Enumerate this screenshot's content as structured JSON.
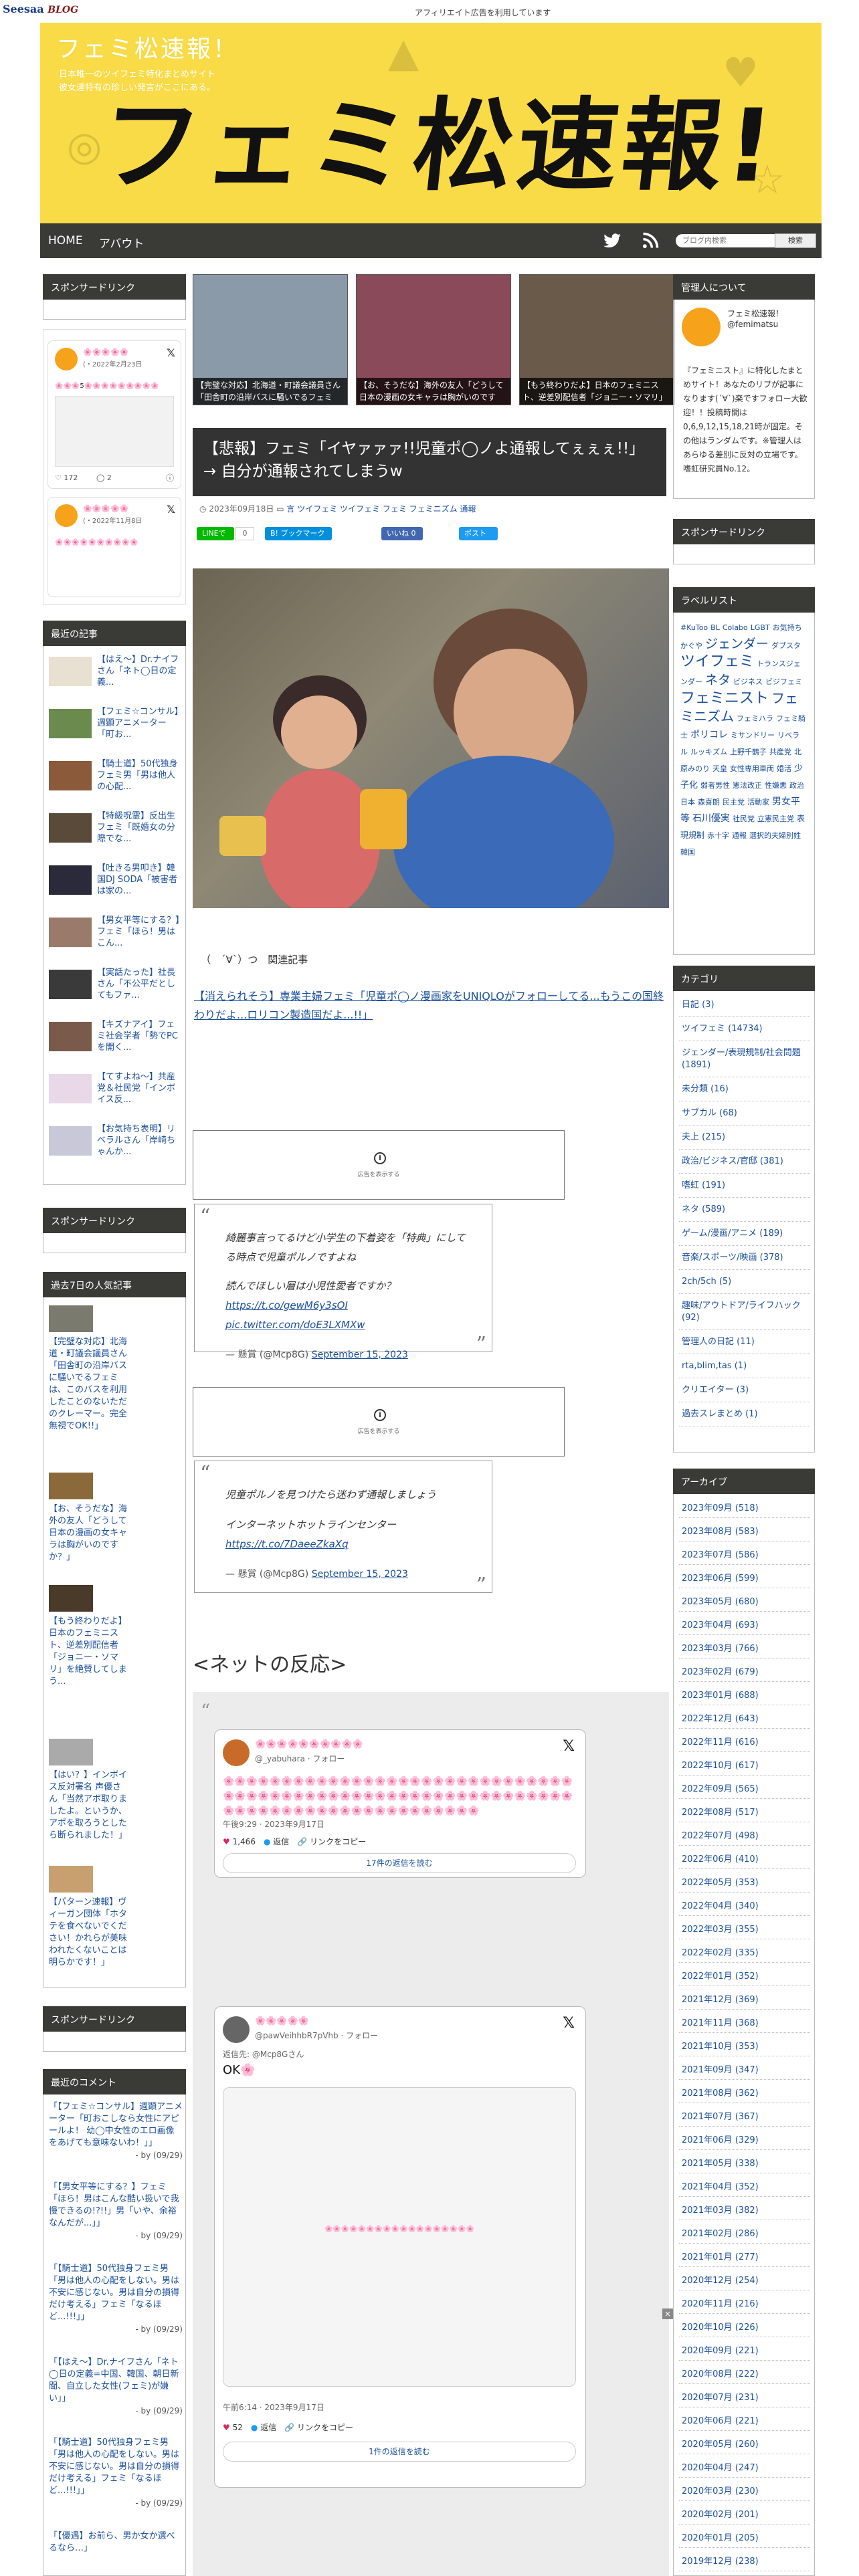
{
  "blog": {
    "logo_main": "Seesaa",
    "logo_sub": "BLOG",
    "ad_notice": "アフィリエイト広告を利用しています"
  },
  "header": {
    "title": "フェミ松速報！",
    "desc_1": "日本唯一のツイフェミ特化まとめサイト",
    "desc_2": "彼女達特有の珍しい発言がここにある。",
    "logo": "フェミ松速報!"
  },
  "nav": {
    "home": "HOME",
    "about": "アバウト",
    "search_placeholder": "ブログ内検索",
    "search_button": "検索"
  },
  "left": {
    "sponsor_title": "スポンサードリンク",
    "sponsor_title_2": "スポンサードリンク",
    "sponsor_title_3": "スポンサードリンク",
    "tweet1": {
      "name": "🌸🌸🌸🌸🌸",
      "date": "(・2022年2月23日",
      "text": "🌸🌸🌸5🌸🌸🌸🌸🌸🌸🌸🌸🌸",
      "likes": "172",
      "replies": "2"
    },
    "tweet2": {
      "name": "🌸🌸🌸🌸🌸",
      "date": "(・2022年11月8日",
      "text": "🌸🌸🌸🌸🌸🌸🌸🌸🌸🌸"
    },
    "recent_title": "最近の記事",
    "recent": [
      "【はえ〜】Dr.ナイフさん「ネト◯日の定義...",
      "【フェミ☆コンサル】週顕アニメーター「町お...",
      "【騎士道】50代独身フェミ男「男は他人の心配...",
      "【特級呪霊】反出生フェミ「既婚女の分際でな...",
      "【吐きる男叩き】韓国DJ SODA「被害者は家の...",
      "【男女平等にする？】フェミ「ほら！男はこん...",
      "【実話たった】社長さん「不公平だとしてもファ...",
      "【キズナアイ】フェミ社会学者「勢でPCを開く...",
      "【てすよね〜】共産党＆社民党「インボイス反...",
      "【お気持ち表明】リベラルさん「岸崎ちゃんか..."
    ],
    "popular_title": "過去7日の人気記事",
    "popular": [
      "【完璧な対応】北海道・町議会議員さん「田舎町の沿岸バスに騒いでるフェミは、このバスを利用したことのないただのクレーマー。完全無視でOK!!」",
      "【お、そうだな】海外の友人「どうして日本の漫画の女キャラは胸がいのですか？」",
      "【もう終わりだよ】日本のフェミニスト、逆差別配信者「ジョニー・ソマリ」を絶賛してしまう...",
      "【はい？】インボイス反対署名 声優さん「当然アボ取りましたよ。というか、アポを取ろうとしたら断られました！」",
      "【パターン速報】ヴィーガン団体「ホタテを食べないでください！かれらが美味われたくないことは明らかです！」"
    ],
    "comments_title": "最近のコメント",
    "comments": [
      {
        "text": "「【フェミ☆コンサル】週顕アニメーター「町おこしなら女性にアピールよ！ 幼◯中女性のエロ画像をあげても意味ないわ！」」",
        "by": "- by",
        "date": "(09/29)"
      },
      {
        "text": "「【男女平等にする？】フェミ「ほら！男はこんな酷い扱いで我慢できるの!?!!」男「いや、余裕なんだが...」」",
        "by": "- by",
        "date": "(09/29)"
      },
      {
        "text": "「【騎士道】50代独身フェミ男「男は他人の心配をしない。男は不安に感じない。男は自分の損得だけ考える」フェミ「なるほど...!!!」」",
        "by": "- by",
        "date": "(09/29)"
      },
      {
        "text": "「【はえ〜】Dr.ナイフさん「ネト◯日の定義=中国、韓国、朝日新聞、自立した女性(フェミ)が嫌い」」",
        "by": "- by",
        "date": "(09/29)"
      },
      {
        "text": "「【騎士道】50代独身フェミ男「男は他人の心配をしない。男は不安に感じない。男は自分の損得だけ考える」フェミ「なるほど...!!!」」",
        "by": "- by",
        "date": "(09/29)"
      },
      {
        "text": "「【優遇】お前ら、男か女か選べるなら…」",
        "by": "",
        "date": ""
      }
    ]
  },
  "main": {
    "featured": [
      "【完璧な対応】北海道・町議会議員さん「田舎町の沿岸バスに騒いでるフェミは...",
      "【お、そうだな】海外の友人「どうして日本の漫画の女キャラは胸がいのですか？」",
      "【もう終わりだよ】日本のフェミニスト、逆差別配信者「ジョニー・ソマリ」を絶賛"
    ],
    "title": "【悲報】フェミ「イヤァァァ!!児童ポ◯ノよ通報してぇぇぇ!!」→ 自分が通報されてしまうw",
    "date": "2023年09月18日",
    "categories": "言 ツイフェミ ツイフェミ フェミ フェミニズム 通報",
    "share_line": "LINEで送る",
    "share_line_count": "0",
    "share_hatena": "B! ブックマーク 4",
    "share_like": "いいね 0",
    "share_tweet": "ポスト",
    "related_label": "（　´∀`）つ　関連記事",
    "related_link": "【消えられそう】専業主婦フェミ「児童ポ◯ノ漫画家をUNIQLOがフォローしてる...もうこの国終わりだよ...ロリコン製造国だよ...!!」",
    "ad_label": "広告を表示する",
    "quote1": {
      "line1": "綺麗事言ってるけど小学生の下着姿を「特典」にして",
      "line1b": "る時点で児童ポルノですよね",
      "line2": "読んでほしい層は小児性愛者ですか？",
      "link": "https://t.co/gewM6y3sOI",
      "pic": "pic.twitter.com/doE3LXMXw",
      "attrib": "— 懸賞 (@Mcp8G)",
      "date": "September 15, 2023"
    },
    "quote2": {
      "line1": "児童ポルノを見つけたら迷わず通報しましょう",
      "line2": "インターネットホットラインセンター",
      "link": "https://t.co/7DaeeZkaXq",
      "attrib": "— 懸賞 (@Mcp8G)",
      "date": "September 15, 2023"
    },
    "net_heading": "<ネットの反応>",
    "embed1": {
      "name": "🌸🌸🌸🌸🌸🌸🌸🌸🌸🌸",
      "handle": "@_yabuhara · フォロー",
      "body": "🌸🌸🌸🌸🌸🌸🌸🌸🌸🌸🌸🌸🌸🌸🌸🌸🌸🌸🌸🌸🌸🌸🌸🌸🌸🌸🌸🌸🌸🌸🌸🌸🌸🌸🌸🌸🌸🌸🌸🌸🌸🌸🌸🌸🌸🌸🌸🌸🌸🌸🌸🌸🌸🌸🌸🌸🌸🌸🌸🌸🌸🌸🌸🌸🌸🌸🌸🌸🌸🌸🌸🌸🌸🌸🌸🌸🌸🌸🌸🌸🌸🌸",
      "time": "午後9:29 · 2023年9月17日",
      "likes": "1,466",
      "reply": "返信",
      "copy": "リンクをコピー",
      "more": "17件の返信を読む"
    },
    "embed2": {
      "name": "🌸🌸🌸🌸🌸",
      "handle": "@pawVeihhbR7pVhb · フォロー",
      "reply_to": "返信先: @Mcp8Gさん",
      "body": "OK🌸",
      "media_notice": "🌸🌸🌸🌸🌸🌸🌸🌸🌸🌸🌸🌸🌸🌸🌸🌸🌸🌸",
      "time": "午前6:14 · 2023年9月17日",
      "likes": "52",
      "reply": "返信",
      "copy": "リンクをコピー",
      "more": "1件の返信を読む"
    }
  },
  "right": {
    "about_title": "管理人について",
    "about_name": "フェミ松速報！",
    "about_handle": "@femimatsu",
    "about_text": "『フェミニスト』に特化したまとめサイト！あなたのリプが記事になります(´∀`)楽ですフォロー大歓迎！！投稿時間は0,6,9,12,15,18,21時が固定。その他はランダムです。※管理人はあらゆる差別に反対の立場です。嗜虹研究員No.12。",
    "sponsor_title": "スポンサードリンク",
    "labels_title": "ラベルリスト",
    "labels": [
      "#KuToo",
      "BL",
      "Colabo",
      "LGBT",
      "お気持ち",
      "かぐや",
      "ジェンダー",
      "ダブスタ",
      "ツイフェミ",
      "トランスジェンダー",
      "ネタ",
      "ビジネス",
      "ビジフェミ",
      "フェミニスト",
      "フェミニズム",
      "フェミハラ",
      "フェミ騎士",
      "ポリコレ",
      "ミサンドリー",
      "リベラル",
      "ルッキズム",
      "上野千鶴子",
      "共産党",
      "北原みのり",
      "天皇",
      "女性専用車両",
      "婚活",
      "少子化",
      "弱者男性",
      "憲法改正",
      "性嫌悪",
      "政治",
      "日本",
      "森喜朗",
      "民主党",
      "活動家",
      "男女平等",
      "石川優実",
      "社民党",
      "立憲民主党",
      "表現規制",
      "赤十字",
      "通報",
      "選択的夫婦別姓",
      "韓国"
    ],
    "cats_title": "カテゴリ",
    "cats": [
      "日記 (3)",
      "ツイフェミ (14734)",
      "ジェンダー/表現規制/社会問題 (1891)",
      "未分類 (16)",
      "サブカル (68)",
      "夫上 (215)",
      "政治/ビジネス/官邸 (381)",
      "嗜虹 (191)",
      "ネタ (589)",
      "ゲーム/漫画/アニメ (189)",
      "音楽/スポーツ/映画 (378)",
      "2ch/5ch (5)",
      "趣味/アウトドア/ライフハック (92)",
      "管理人の日記 (11)",
      "rta,blim,tas (1)",
      "クリエイター (3)",
      "過去スレまとめ (1)"
    ],
    "archive_title": "アーカイブ",
    "archive": [
      "2023年09月 (518)",
      "2023年08月 (583)",
      "2023年07月 (586)",
      "2023年06月 (599)",
      "2023年05月 (680)",
      "2023年04月 (693)",
      "2023年03月 (766)",
      "2023年02月 (679)",
      "2023年01月 (688)",
      "2022年12月 (643)",
      "2022年11月 (616)",
      "2022年10月 (617)",
      "2022年09月 (565)",
      "2022年08月 (517)",
      "2022年07月 (498)",
      "2022年06月 (410)",
      "2022年05月 (353)",
      "2022年04月 (340)",
      "2022年03月 (355)",
      "2022年02月 (335)",
      "2022年01月 (352)",
      "2021年12月 (369)",
      "2021年11月 (368)",
      "2021年10月 (353)",
      "2021年09月 (347)",
      "2021年08月 (362)",
      "2021年07月 (367)",
      "2021年06月 (329)",
      "2021年05月 (338)",
      "2021年04月 (352)",
      "2021年03月 (382)",
      "2021年02月 (286)",
      "2021年01月 (277)",
      "2020年12月 (254)",
      "2020年11月 (216)",
      "2020年10月 (226)",
      "2020年09月 (221)",
      "2020年08月 (222)",
      "2020年07月 (231)",
      "2020年06月 (221)",
      "2020年05月 (260)",
      "2020年04月 (247)",
      "2020年03月 (230)",
      "2020年02月 (201)",
      "2020年01月 (205)",
      "2019年12月 (238)"
    ]
  }
}
